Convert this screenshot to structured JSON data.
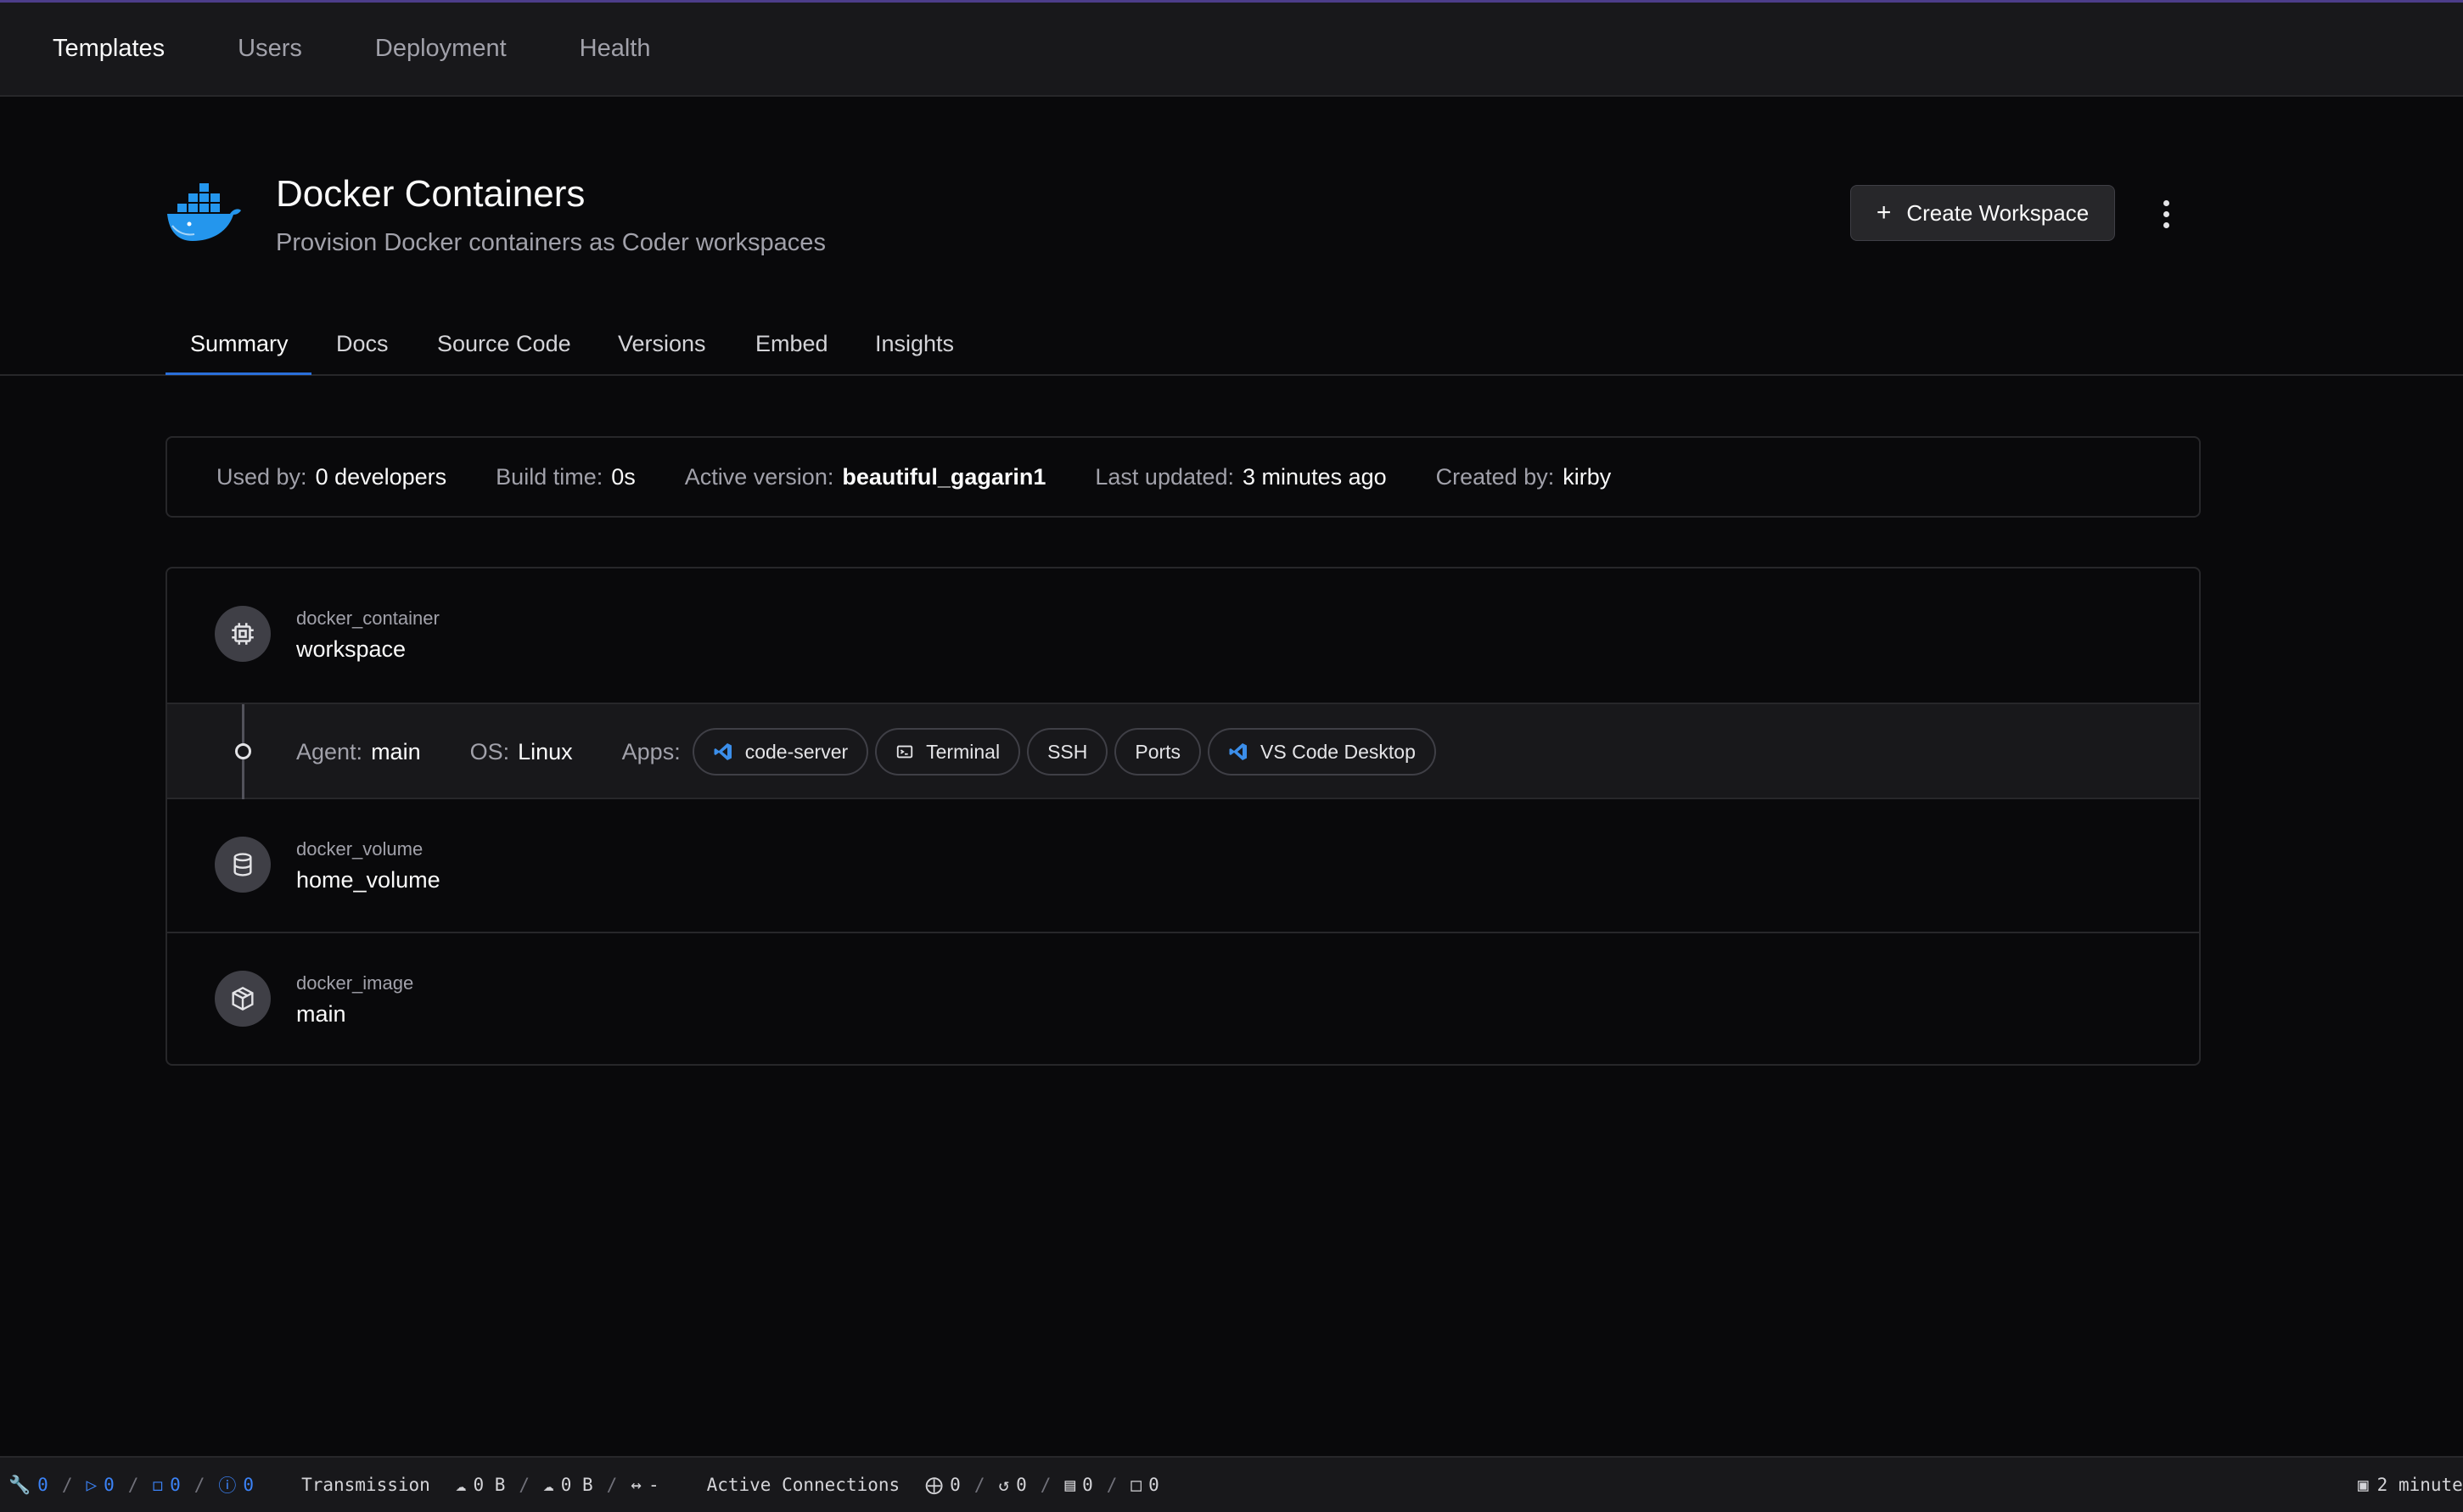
{
  "nav": {
    "items": [
      {
        "label": "Templates",
        "active": true
      },
      {
        "label": "Users"
      },
      {
        "label": "Deployment"
      },
      {
        "label": "Health"
      }
    ]
  },
  "template": {
    "title": "Docker Containers",
    "subtitle": "Provision Docker containers as Coder workspaces",
    "logo_icon": "docker-whale-icon",
    "create_label": "Create Workspace"
  },
  "tabs": [
    {
      "label": "Summary",
      "active": true
    },
    {
      "label": "Docs"
    },
    {
      "label": "Source Code"
    },
    {
      "label": "Versions"
    },
    {
      "label": "Embed"
    },
    {
      "label": "Insights"
    }
  ],
  "stats": {
    "used_by": {
      "label": "Used by:",
      "value": "0 developers"
    },
    "build_time": {
      "label": "Build time:",
      "value": "0s"
    },
    "active_version": {
      "label": "Active version:",
      "value": "beautiful_gagarin1"
    },
    "last_updated": {
      "label": "Last updated:",
      "value": "3 minutes ago"
    },
    "created_by": {
      "label": "Created by:",
      "value": "kirby"
    }
  },
  "resources": [
    {
      "type": "docker_container",
      "name": "workspace",
      "icon": "chip-icon"
    },
    {
      "type": "docker_volume",
      "name": "home_volume",
      "icon": "database-icon"
    },
    {
      "type": "docker_image",
      "name": "main",
      "icon": "package-icon"
    }
  ],
  "agent": {
    "agent_label": "Agent:",
    "agent_value": "main",
    "os_label": "OS:",
    "os_value": "Linux",
    "apps_label": "Apps:",
    "apps": [
      {
        "label": "code-server",
        "icon": "vscode-icon"
      },
      {
        "label": "Terminal",
        "icon": "terminal-icon"
      },
      {
        "label": "SSH"
      },
      {
        "label": "Ports"
      },
      {
        "label": "VS Code Desktop",
        "icon": "vscode-icon"
      }
    ]
  },
  "statusbar": {
    "counts": [
      "0",
      "0",
      "0",
      "0"
    ],
    "transmission_label": "Transmission",
    "upload": "0 B",
    "download": "0 B",
    "latency": "-",
    "connections_label": "Active Connections",
    "connections": [
      "0",
      "0",
      "0",
      "0"
    ],
    "right_text": "2 minute"
  },
  "colors": {
    "accent": "#2a6fdb",
    "background": "#09090b",
    "surface": "#18181b",
    "docker_blue": "#2496ed"
  }
}
